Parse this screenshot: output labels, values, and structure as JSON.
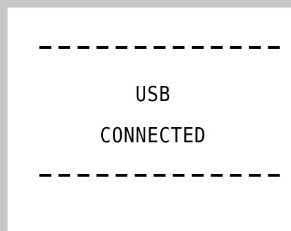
{
  "display": {
    "separator_top": "-------------",
    "line1": "USB",
    "line2": "CONNECTED",
    "separator_bottom": "-------------"
  },
  "colors": {
    "frame": "#c8c8c8",
    "background": "#ffffff",
    "text": "#000000"
  }
}
